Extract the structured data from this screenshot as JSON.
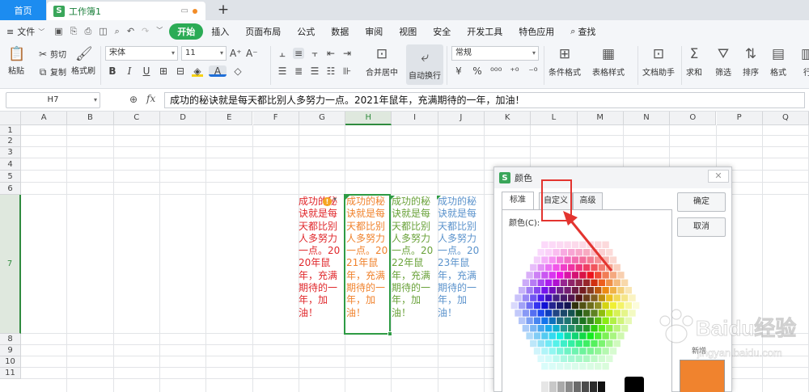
{
  "tabbar": {
    "home": "首页",
    "doc_title": "工作簿1",
    "new_tab": "+"
  },
  "menubar": {
    "file": "文件",
    "tabs": [
      "开始",
      "插入",
      "页面布局",
      "公式",
      "数据",
      "审阅",
      "视图",
      "安全",
      "开发工具",
      "特色应用"
    ],
    "active_tab": "开始",
    "search": "查找"
  },
  "ribbon": {
    "paste": "粘贴",
    "cut": "剪切",
    "copy": "复制",
    "format_painter": "格式刷",
    "font_name": "宋体",
    "font_size": "11",
    "merge_center": "合并居中",
    "auto_wrap": "自动换行",
    "number_format": "常规",
    "cond_format": "条件格式",
    "table_style": "表格样式",
    "doc_assistant": "文档助手",
    "sum": "求和",
    "filter": "筛选",
    "sort": "排序",
    "format": "格式",
    "row": "行"
  },
  "formula_bar": {
    "name_box": "H7",
    "fx": "fx",
    "content": "成功的秘诀就是每天都比别人多努力一点。2021年鼠年，充满期待的一年，加油！"
  },
  "grid": {
    "columns": [
      "A",
      "B",
      "C",
      "D",
      "E",
      "F",
      "G",
      "H",
      "I",
      "J",
      "K",
      "L",
      "M",
      "N",
      "O",
      "P",
      "Q"
    ],
    "selected_column": "H",
    "rows": [
      "1",
      "2",
      "3",
      "4",
      "5",
      "6",
      "7",
      "8",
      "9",
      "10",
      "11"
    ],
    "selected_row": "7",
    "cells": {
      "G7": "成功的秘诀就是每天都比别人多努力一点。2020年鼠年，充满期待的一年，加油！",
      "H7": "成功的秘诀就是每天都比别人多努力一点。2021年鼠年，充满期待的一年，加油！",
      "I7": "成功的秘诀就是每天都比别人多努力一点。2022年鼠年，充满期待的一年，加油！",
      "J7": "成功的秘诀就是每天都比别人多努力一点。2023年鼠年，充满期待的一年，加油！"
    },
    "cell_colors": {
      "G7": "#e0282c",
      "H7": "#f0832e",
      "I7": "#6aa23a",
      "J7": "#5b93cc"
    }
  },
  "dialog": {
    "title": "颜色",
    "tabs": [
      "标准",
      "自定义",
      "高级"
    ],
    "active_tab": "标准",
    "color_label": "颜色(C):",
    "ok": "确定",
    "cancel": "取消",
    "new_label": "新增",
    "new_color": "#f0832e"
  },
  "watermark": {
    "brand": "Baidu经验",
    "url": "jingyan.baidu.com"
  },
  "colors": {
    "accent_green": "#2bab55",
    "home_blue": "#1c8cf0",
    "annotation_red": "#e3342f"
  }
}
